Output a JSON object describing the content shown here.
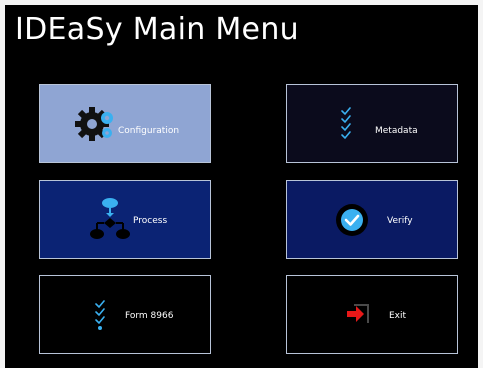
{
  "window": {
    "title": "IDEaSy Main Menu"
  },
  "menu": {
    "configuration": {
      "label": "Configuration",
      "icon": "gear-icon"
    },
    "metadata": {
      "label": "Metadata",
      "icon": "checklist-icon"
    },
    "process": {
      "label": "Process",
      "icon": "flowchart-icon"
    },
    "verify": {
      "label": "Verify",
      "icon": "check-circle-icon"
    },
    "form": {
      "label": "Form 8966",
      "icon": "checklist-icon"
    },
    "exit": {
      "label": "Exit",
      "icon": "exit-arrow-icon"
    }
  },
  "colors": {
    "background": "#000000",
    "config_tile": "#8fa5d3",
    "process_tile": "#0b2374",
    "verify_tile": "#0a1a63",
    "accent_blue": "#3ab0f0",
    "exit_red": "#e81818"
  }
}
